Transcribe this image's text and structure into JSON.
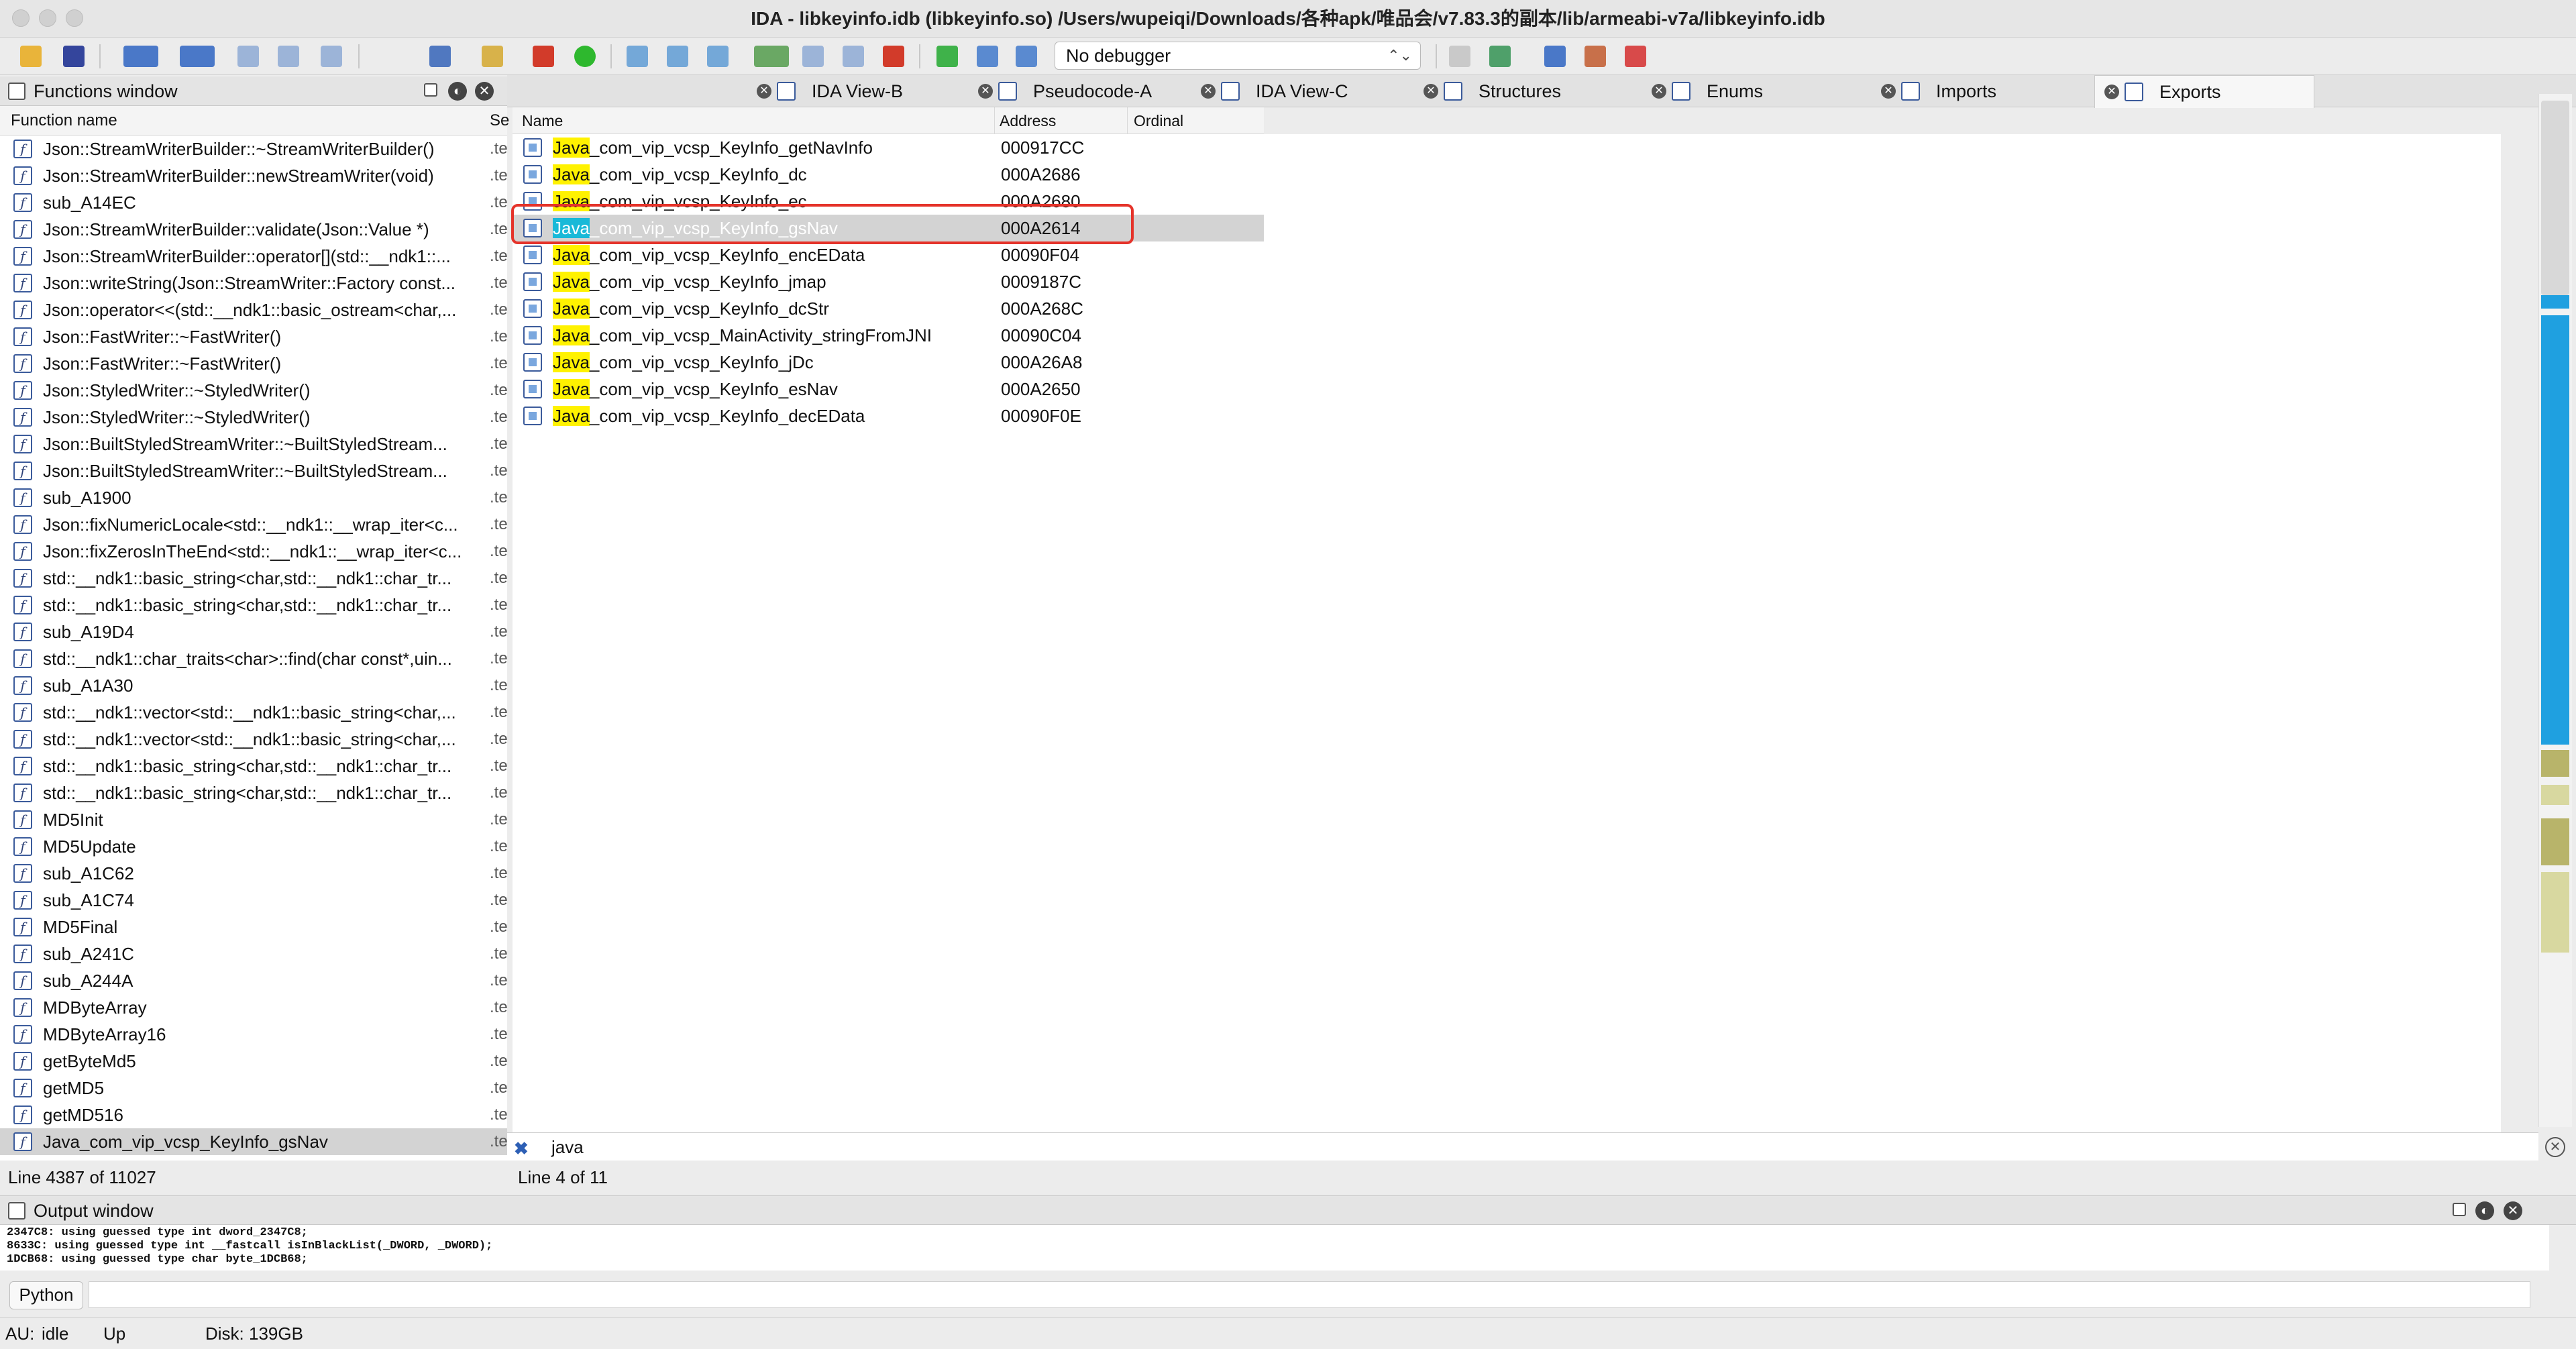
{
  "window": {
    "title": "IDA - libkeyinfo.idb (libkeyinfo.so) /Users/wupeiqi/Downloads/各种apk/唯品会/v7.83.3的副本/lib/armeabi-v7a/libkeyinfo.idb"
  },
  "toolbar": {
    "debugger": "No debugger"
  },
  "functions_window": {
    "title": "Functions window",
    "col_name": "Function name",
    "col_segment": "Se",
    "items": [
      {
        "name": "Json::StreamWriterBuilder::~StreamWriterBuilder()",
        "seg": ".te"
      },
      {
        "name": "Json::StreamWriterBuilder::newStreamWriter(void)",
        "seg": ".te"
      },
      {
        "name": "sub_A14EC",
        "seg": ".te"
      },
      {
        "name": "Json::StreamWriterBuilder::validate(Json::Value *)",
        "seg": ".te"
      },
      {
        "name": "Json::StreamWriterBuilder::operator[](std::__ndk1::...",
        "seg": ".te"
      },
      {
        "name": "Json::writeString(Json::StreamWriter::Factory const...",
        "seg": ".te"
      },
      {
        "name": "Json::operator<<(std::__ndk1::basic_ostream<char,...",
        "seg": ".te"
      },
      {
        "name": "Json::FastWriter::~FastWriter()",
        "seg": ".te"
      },
      {
        "name": "Json::FastWriter::~FastWriter()",
        "seg": ".te"
      },
      {
        "name": "Json::StyledWriter::~StyledWriter()",
        "seg": ".te"
      },
      {
        "name": "Json::StyledWriter::~StyledWriter()",
        "seg": ".te"
      },
      {
        "name": "Json::BuiltStyledStreamWriter::~BuiltStyledStream...",
        "seg": ".te"
      },
      {
        "name": "Json::BuiltStyledStreamWriter::~BuiltStyledStream...",
        "seg": ".te"
      },
      {
        "name": "sub_A1900",
        "seg": ".te"
      },
      {
        "name": "Json::fixNumericLocale<std::__ndk1::__wrap_iter<c...",
        "seg": ".te"
      },
      {
        "name": "Json::fixZerosInTheEnd<std::__ndk1::__wrap_iter<c...",
        "seg": ".te"
      },
      {
        "name": "std::__ndk1::basic_string<char,std::__ndk1::char_tr...",
        "seg": ".te"
      },
      {
        "name": "std::__ndk1::basic_string<char,std::__ndk1::char_tr...",
        "seg": ".te"
      },
      {
        "name": "sub_A19D4",
        "seg": ".te"
      },
      {
        "name": "std::__ndk1::char_traits<char>::find(char const*,uin...",
        "seg": ".te"
      },
      {
        "name": "sub_A1A30",
        "seg": ".te"
      },
      {
        "name": "std::__ndk1::vector<std::__ndk1::basic_string<char,...",
        "seg": ".te"
      },
      {
        "name": "std::__ndk1::vector<std::__ndk1::basic_string<char,...",
        "seg": ".te"
      },
      {
        "name": "std::__ndk1::basic_string<char,std::__ndk1::char_tr...",
        "seg": ".te"
      },
      {
        "name": "std::__ndk1::basic_string<char,std::__ndk1::char_tr...",
        "seg": ".te"
      },
      {
        "name": "MD5Init",
        "seg": ".te"
      },
      {
        "name": "MD5Update",
        "seg": ".te"
      },
      {
        "name": "sub_A1C62",
        "seg": ".te"
      },
      {
        "name": "sub_A1C74",
        "seg": ".te"
      },
      {
        "name": "MD5Final",
        "seg": ".te"
      },
      {
        "name": "sub_A241C",
        "seg": ".te"
      },
      {
        "name": "sub_A244A",
        "seg": ".te"
      },
      {
        "name": "MDByteArray",
        "seg": ".te"
      },
      {
        "name": "MDByteArray16",
        "seg": ".te"
      },
      {
        "name": "getByteMd5",
        "seg": ".te"
      },
      {
        "name": "getMD5",
        "seg": ".te"
      },
      {
        "name": "getMD516",
        "seg": ".te"
      },
      {
        "name": "Java_com_vip_vcsp_KeyInfo_gsNav",
        "seg": ".te",
        "selected": true
      }
    ],
    "status": "Line 4387 of 11027"
  },
  "tabs": [
    {
      "label": "IDA View-B"
    },
    {
      "label": "Pseudocode-A"
    },
    {
      "label": "IDA View-C"
    },
    {
      "label": "Structures"
    },
    {
      "label": "Enums"
    },
    {
      "label": "Imports"
    },
    {
      "label": "Exports",
      "active": true
    }
  ],
  "exports": {
    "col_name": "Name",
    "col_address": "Address",
    "col_ordinal": "Ordinal",
    "rows": [
      {
        "prefix": "Java",
        "rest": "_com_vip_vcsp_KeyInfo_getNavInfo",
        "address": "000917CC"
      },
      {
        "prefix": "Java",
        "rest": "_com_vip_vcsp_KeyInfo_dc",
        "address": "000A2686"
      },
      {
        "prefix": "Java",
        "rest": "_com_vip_vcsp_KeyInfo_ec",
        "address": "000A2680"
      },
      {
        "prefix": "Java",
        "rest": "_com_vip_vcsp_KeyInfo_gsNav",
        "address": "000A2614",
        "selected": true
      },
      {
        "prefix": "Java",
        "rest": "_com_vip_vcsp_KeyInfo_encEData",
        "address": "00090F04"
      },
      {
        "prefix": "Java",
        "rest": "_com_vip_vcsp_KeyInfo_jmap",
        "address": "0009187C"
      },
      {
        "prefix": "Java",
        "rest": "_com_vip_vcsp_KeyInfo_dcStr",
        "address": "000A268C"
      },
      {
        "prefix": "Java",
        "rest": "_com_vip_vcsp_MainActivity_stringFromJNI",
        "address": "00090C04"
      },
      {
        "prefix": "Java",
        "rest": "_com_vip_vcsp_KeyInfo_jDc",
        "address": "000A26A8"
      },
      {
        "prefix": "Java",
        "rest": "_com_vip_vcsp_KeyInfo_esNav",
        "address": "000A2650"
      },
      {
        "prefix": "Java",
        "rest": "_com_vip_vcsp_KeyInfo_decEData",
        "address": "00090F0E"
      }
    ],
    "search_value": "java",
    "status": "Line 4 of 11"
  },
  "output_window": {
    "title": "Output window",
    "lines": [
      "2347C8: using guessed type int dword_2347C8;",
      "8633C: using guessed type int __fastcall isInBlackList(_DWORD, _DWORD);",
      "1DCB68: using guessed type char byte_1DCB68;"
    ],
    "python_label": "Python"
  },
  "statusbar": {
    "au": "AU:",
    "au_state": "idle",
    "direction": "Up",
    "disk": "Disk: 139GB"
  }
}
